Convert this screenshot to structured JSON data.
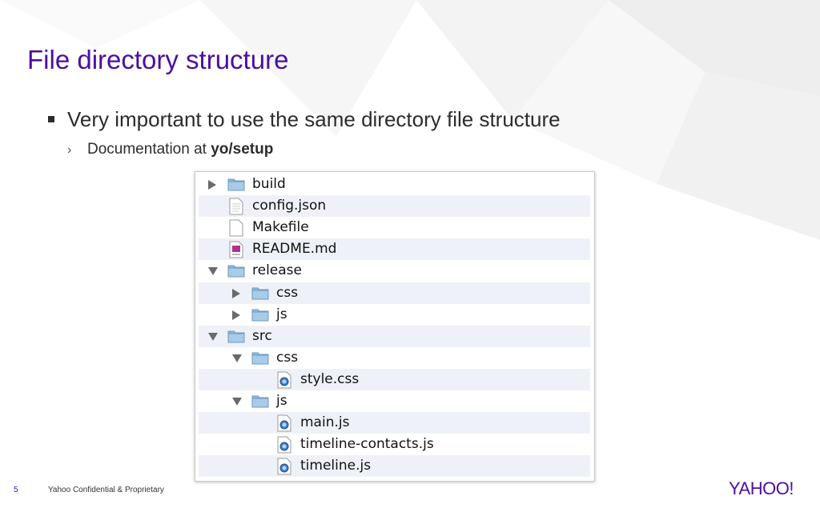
{
  "slide": {
    "title": "File directory structure",
    "bullet_main": "Very important to use the same directory file structure",
    "bullet_sub_prefix": "Documentation at ",
    "bullet_sub_bold": "yo/setup",
    "bullet_sub_chevron": "›"
  },
  "finder": {
    "rows": [
      {
        "name": "build",
        "kind": "folder",
        "disclosure": "collapsed",
        "depth": 0,
        "icon": "folder-icon"
      },
      {
        "name": "config.json",
        "kind": "file",
        "depth": 0,
        "icon": "text-file-icon"
      },
      {
        "name": "Makefile",
        "kind": "file",
        "depth": 0,
        "icon": "blank-file-icon"
      },
      {
        "name": "README.md",
        "kind": "file",
        "depth": 0,
        "icon": "markdown-file-icon"
      },
      {
        "name": "release",
        "kind": "folder",
        "disclosure": "expanded",
        "depth": 0,
        "icon": "folder-icon"
      },
      {
        "name": "css",
        "kind": "folder",
        "disclosure": "collapsed",
        "depth": 1,
        "icon": "folder-icon"
      },
      {
        "name": "js",
        "kind": "folder",
        "disclosure": "collapsed",
        "depth": 1,
        "icon": "folder-icon"
      },
      {
        "name": "src",
        "kind": "folder",
        "disclosure": "expanded",
        "depth": 0,
        "icon": "folder-icon"
      },
      {
        "name": "css",
        "kind": "folder",
        "disclosure": "expanded",
        "depth": 1,
        "icon": "folder-icon"
      },
      {
        "name": "style.css",
        "kind": "file",
        "depth": 2,
        "icon": "web-file-icon"
      },
      {
        "name": "js",
        "kind": "folder",
        "disclosure": "expanded",
        "depth": 1,
        "icon": "folder-icon"
      },
      {
        "name": "main.js",
        "kind": "file",
        "depth": 2,
        "icon": "web-file-icon"
      },
      {
        "name": "timeline-contacts.js",
        "kind": "file",
        "depth": 2,
        "icon": "web-file-icon"
      },
      {
        "name": "timeline.js",
        "kind": "file",
        "depth": 2,
        "icon": "web-file-icon"
      }
    ]
  },
  "footer": {
    "page_number": "5",
    "confidential": "Yahoo Confidential & Proprietary",
    "logo_text": "YAHOO!"
  },
  "colors": {
    "brand_purple": "#4b0fa0",
    "row_stripe": "#eef2f8",
    "folder_blue": "#8fb9de"
  }
}
